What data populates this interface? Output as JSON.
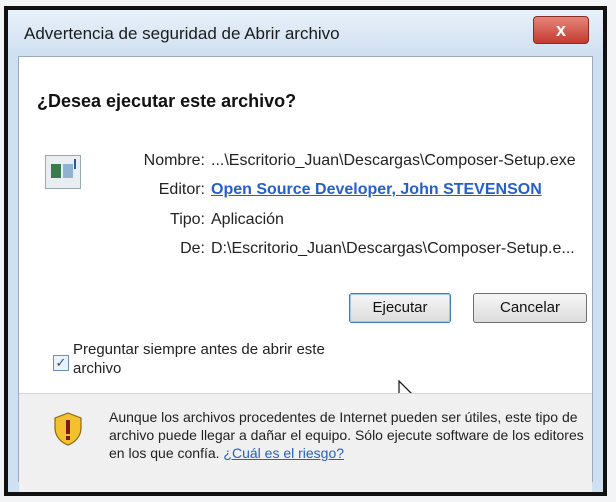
{
  "window": {
    "title": "Advertencia de seguridad de Abrir archivo",
    "close_label": "x"
  },
  "dialog": {
    "heading": "¿Desea ejecutar este archivo?",
    "fields": {
      "nombre_label": "Nombre:",
      "nombre_value": "...\\Escritorio_Juan\\Descargas\\Composer-Setup.exe",
      "editor_label": "Editor:",
      "editor_value": "Open Source Developer, John STEVENSON",
      "tipo_label": "Tipo:",
      "tipo_value": "Aplicación",
      "de_label": "De:",
      "de_value": "D:\\Escritorio_Juan\\Descargas\\Composer-Setup.e..."
    },
    "buttons": {
      "run": "Ejecutar",
      "cancel": "Cancelar"
    },
    "checkbox": {
      "checked": true,
      "label": "Preguntar siempre antes de abrir este archivo"
    },
    "info": {
      "text": "Aunque los archivos procedentes de Internet pueden ser útiles, este tipo de archivo puede llegar a dañar el equipo. Sólo ejecute software de los editores en los que confía.",
      "link": "¿Cuál es el riesgo?"
    }
  },
  "icons": {
    "file": "application-file-icon",
    "shield": "warning-shield-icon",
    "cursor": "mouse-pointer-icon"
  },
  "colors": {
    "link": "#2460c8",
    "close_button": "#c43b2f"
  }
}
